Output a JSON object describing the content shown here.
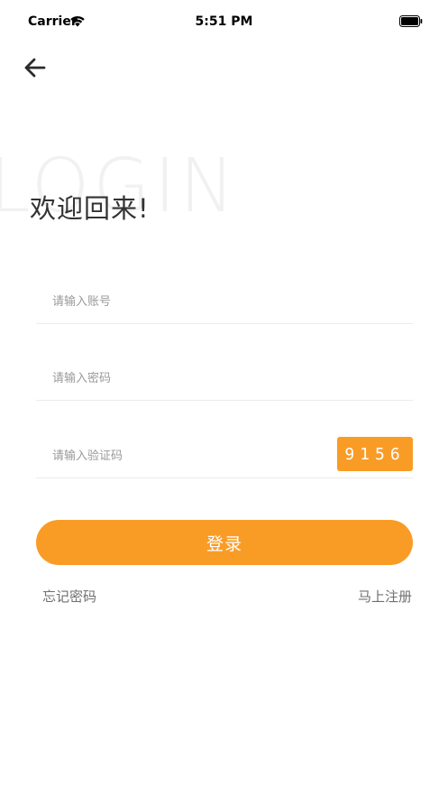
{
  "status_bar": {
    "carrier": "Carrier",
    "time": "5:51 PM"
  },
  "nav": {
    "back_icon": "arrow-left-icon"
  },
  "heading": {
    "watermark": "LOGIN",
    "title": "欢迎回来!"
  },
  "form": {
    "account_placeholder": "请输入账号",
    "account_value": "",
    "password_placeholder": "请输入密码",
    "password_value": "",
    "captcha_placeholder": "请输入验证码",
    "captcha_value": "",
    "captcha_code": "9156"
  },
  "actions": {
    "login_label": "登录",
    "forgot_label": "忘记密码",
    "register_label": "马上注册"
  },
  "colors": {
    "accent": "#f99c26",
    "text_primary": "#333333",
    "text_secondary": "#6f6f6f",
    "placeholder": "#9a9a9a",
    "divider": "#ececec"
  }
}
